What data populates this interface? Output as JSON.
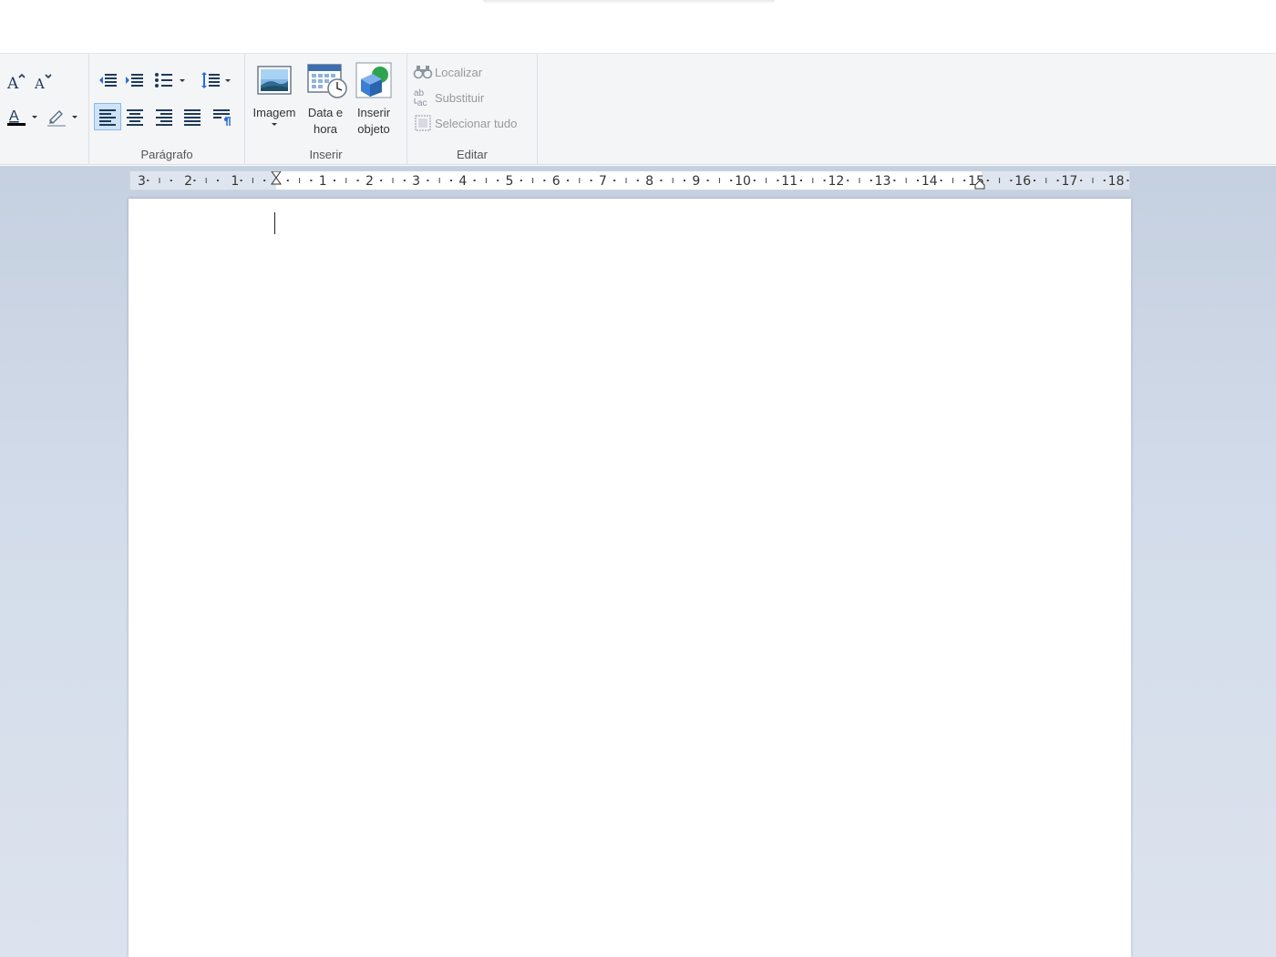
{
  "ribbon": {
    "font_group": {
      "grow_font": "grow-font-icon",
      "shrink_font": "shrink-font-icon",
      "text_color": "text-color-icon",
      "highlight": "highlight-icon",
      "text_color_value": "#000000"
    },
    "paragraph_group": {
      "label": "Parágrafo",
      "decrease_indent": "decrease-indent-icon",
      "increase_indent": "increase-indent-icon",
      "bullets": "bullet-list-icon",
      "line_spacing": "line-spacing-icon",
      "align_left": "align-left-icon",
      "align_center": "align-center-icon",
      "align_right": "align-right-icon",
      "justify": "justify-icon",
      "paragraph": "paragraph-icon",
      "active_alignment": "align-left"
    },
    "insert_group": {
      "label": "Inserir",
      "buttons": [
        {
          "label": "Imagem",
          "icon": "picture-icon"
        },
        {
          "label": "Data e\nhora",
          "icon": "calendar-clock-icon"
        },
        {
          "label": "Inserir\nobjeto",
          "icon": "object-icon"
        }
      ]
    },
    "edit_group": {
      "label": "Editar",
      "find": "Localizar",
      "replace": "Substituir",
      "select_all": "Selecionar tudo"
    }
  },
  "ruler": {
    "left_labels": [
      "3",
      "2",
      "1"
    ],
    "right_labels": [
      "1",
      "2",
      "3",
      "4",
      "5",
      "6",
      "7",
      "8",
      "9",
      "10",
      "11",
      "12",
      "13",
      "14",
      "15",
      "16",
      "17",
      "18"
    ]
  },
  "colors": {
    "accent": "#2b6bd6",
    "workspace": "#c5d0e0",
    "ribbon": "#f4f5f7"
  }
}
